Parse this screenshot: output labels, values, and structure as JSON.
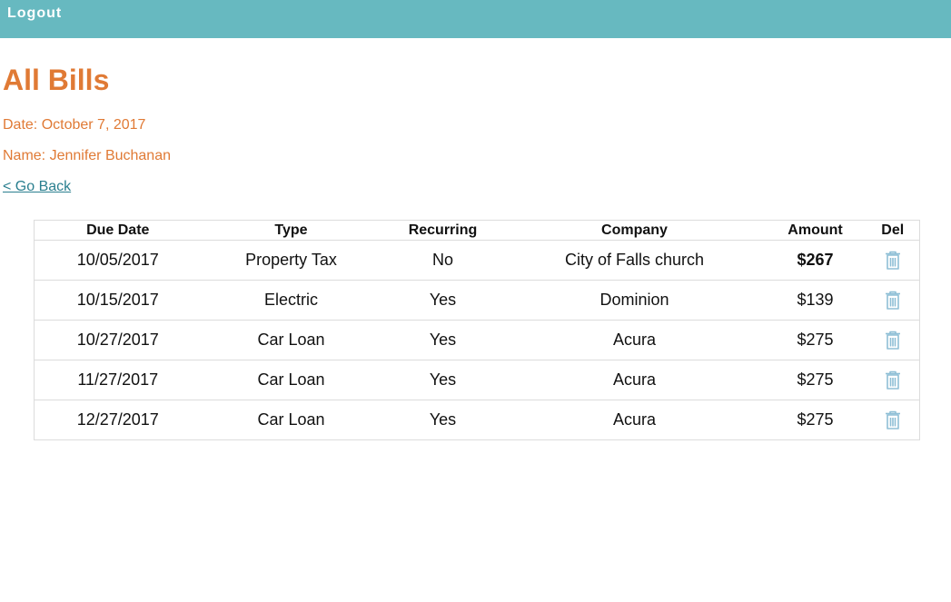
{
  "topbar": {
    "logout_label": "Logout"
  },
  "page": {
    "title": "All Bills",
    "date_text": "Date: October 7, 2017",
    "name_text": "Name: Jennifer Buchanan",
    "go_back_label": "< Go Back"
  },
  "table": {
    "headers": [
      "Due Date",
      "Type",
      "Recurring",
      "Company",
      "Amount",
      "Del"
    ],
    "rows": [
      {
        "due_date": "10/05/2017",
        "type": "Property Tax",
        "recurring": "No",
        "company": "City of Falls church",
        "amount": "$267",
        "amount_status": "green"
      },
      {
        "due_date": "10/15/2017",
        "type": "Electric",
        "recurring": "Yes",
        "company": "Dominion",
        "amount": "$139",
        "amount_status": "red"
      },
      {
        "due_date": "10/27/2017",
        "type": "Car Loan",
        "recurring": "Yes",
        "company": "Acura",
        "amount": "$275",
        "amount_status": "red"
      },
      {
        "due_date": "11/27/2017",
        "type": "Car Loan",
        "recurring": "Yes",
        "company": "Acura",
        "amount": "$275",
        "amount_status": "red"
      },
      {
        "due_date": "12/27/2017",
        "type": "Car Loan",
        "recurring": "Yes",
        "company": "Acura",
        "amount": "$275",
        "amount_status": "red"
      }
    ],
    "delete_icon": "trash-icon"
  },
  "colors": {
    "topbar": "#67b9c0",
    "title": "#e07a35",
    "link": "#2a7f8f",
    "amount_green": "#1a8a1a",
    "amount_red": "#e8202a",
    "trash_icon": "#8fbfd6"
  }
}
